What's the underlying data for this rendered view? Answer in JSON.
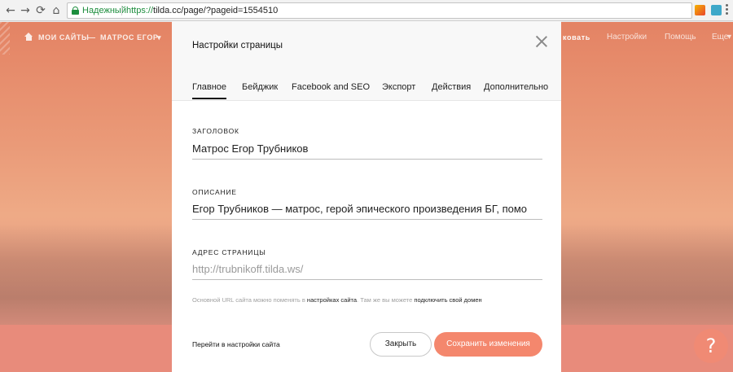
{
  "browser": {
    "back": "←",
    "forward": "→",
    "reload": "⟳",
    "home": "⌂",
    "secure_label": "Надежный",
    "url_scheme": "https://",
    "url_rest": "tilda.cc/page/?pageid=1554510",
    "star": "☆"
  },
  "site_nav": {
    "breadcrumb_1": "МОИ САЙТЫ",
    "breadcrumb_sep": "—",
    "breadcrumb_2": "МАТРОС ЕГОР",
    "chevron": "▾",
    "publish_partial": "ковать",
    "settings": "Настройки",
    "help": "Помощь",
    "more": "Еще",
    "more_chevron": "▾"
  },
  "modal": {
    "title": "Настройки страницы",
    "tabs": [
      "Главное",
      "Бейджик",
      "Facebook and SEO",
      "Экспорт",
      "Действия",
      "Дополнительно"
    ],
    "title_label": "ЗАГОЛОВОК",
    "title_value": "Матрос Егор Трубников",
    "description_label": "ОПИСАНИЕ",
    "description_value": "Егор Трубников — матрос, герой эпического произведения БГ, помо",
    "address_label": "АДРЕС СТРАНИЦЫ",
    "address_placeholder": "http://trubnikoff.tilda.ws/",
    "hint_part1": "Основной URL сайта можно поменять в ",
    "hint_link1": "настройках сайта",
    "hint_part2": ". Там же вы можете ",
    "hint_link2": "подключить свой домен",
    "goto_settings": "Перейти в настройки сайта",
    "close_button": "Закрыть",
    "save_button": "Сохранить изменения"
  },
  "help_button": "?",
  "colors": {
    "accent": "#f4876d",
    "secure_green": "#1e8e3e"
  }
}
